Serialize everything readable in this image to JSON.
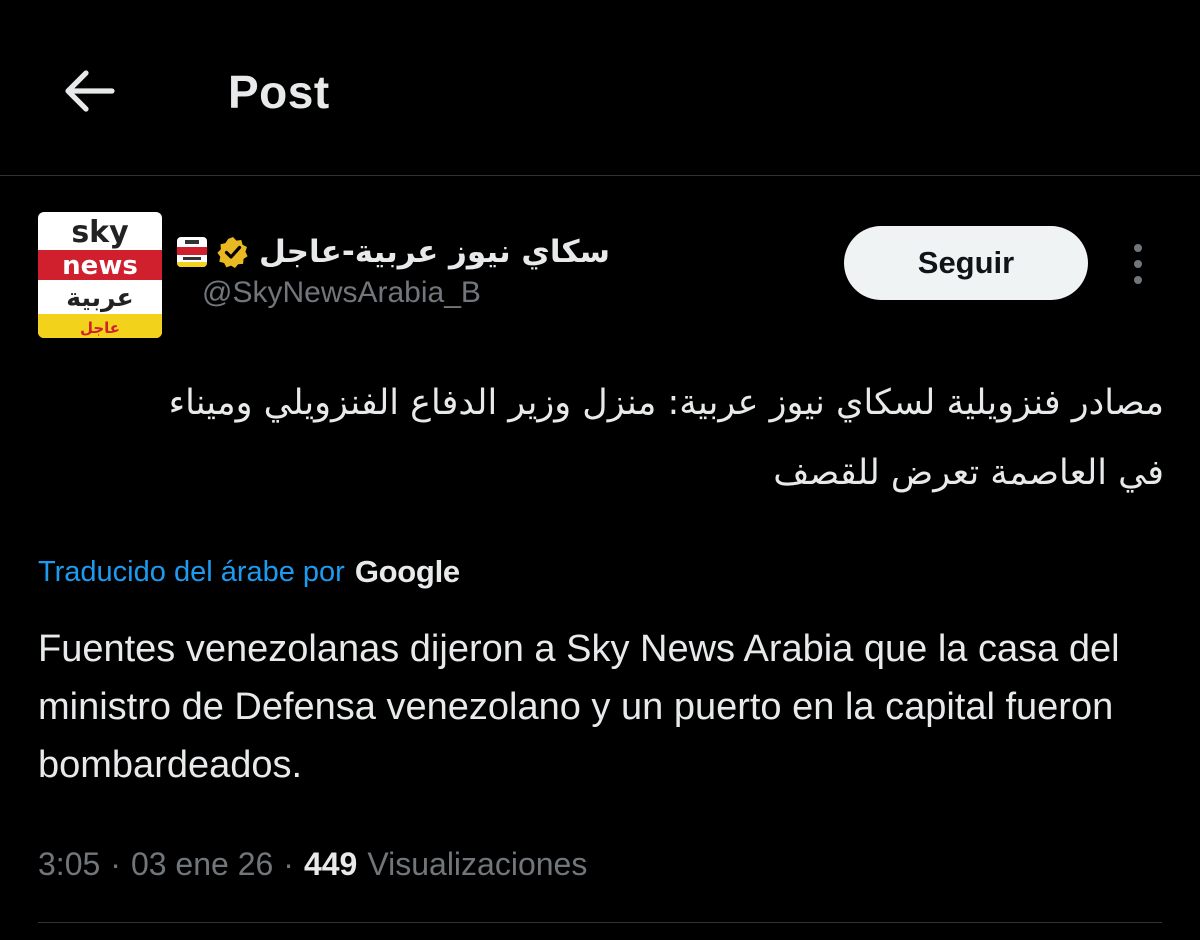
{
  "header": {
    "title": "Post"
  },
  "post": {
    "author": {
      "display_name": "سكاي نيوز عربية-عاجل",
      "handle": "@SkyNewsArabia_B",
      "verified_badge_color": "#e8b923",
      "avatar_logo": {
        "line1": "sky",
        "line2": "news",
        "line3": "عربية",
        "line4": "عاجل"
      }
    },
    "follow_label": "Seguir",
    "text_lines": [
      "مصادر فنزويلية لسكاي نيوز عربية: منزل وزير الدفاع الفنزويلي وميناء",
      "في العاصمة تعرض للقصف"
    ],
    "translation_label": "Traducido del árabe por",
    "translation_provider": "Google",
    "translated_text": "Fuentes venezolanas dijeron a Sky News Arabia que la casa del ministro de Defensa venezolano y un puerto en la capital fueron bombardeados.",
    "meta": {
      "time": "3:05",
      "date": "03 ene 26",
      "separator": "·",
      "views_count": "449",
      "views_label": "Visualizaciones"
    }
  },
  "colors": {
    "background": "#000000",
    "text_primary": "#e7e9ea",
    "text_secondary": "#71767b",
    "link": "#1d9bf0",
    "divider": "#2f3336",
    "sky_red": "#d0202e",
    "sky_yellow": "#f2d21b"
  }
}
